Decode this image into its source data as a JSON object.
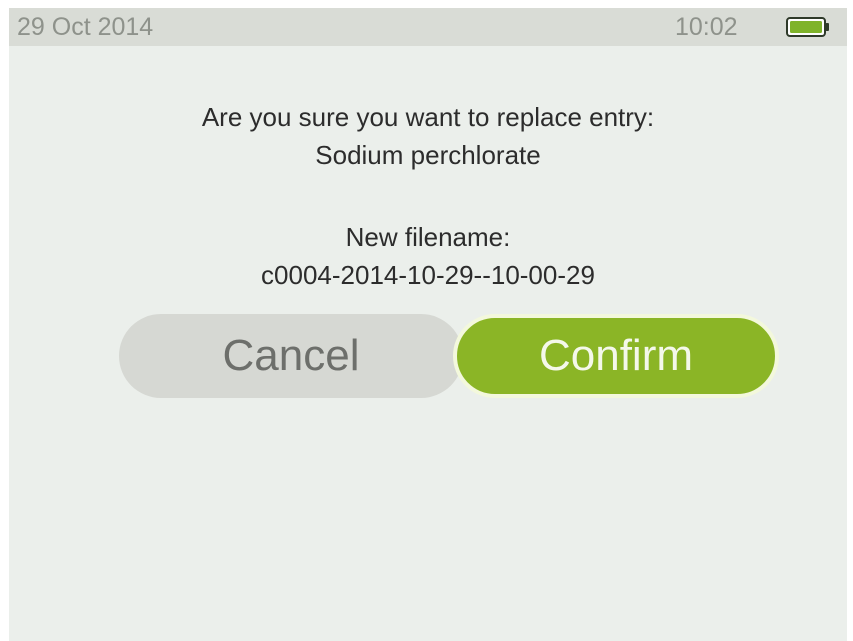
{
  "status_bar": {
    "date": "29 Oct 2014",
    "time": "10:02",
    "battery_icon": "battery-full-icon",
    "battery_color": "#7fb32a"
  },
  "dialog": {
    "question": "Are you sure you want to replace entry:",
    "entry_name": "Sodium perchlorate",
    "filename_label": "New filename:",
    "filename_value": "c0004-2014-10-29--10-00-29"
  },
  "buttons": {
    "cancel_label": "Cancel",
    "confirm_label": "Confirm"
  },
  "colors": {
    "accent": "#8bb526",
    "background": "#ebefeb",
    "status_bar": "#d9dcd6"
  }
}
